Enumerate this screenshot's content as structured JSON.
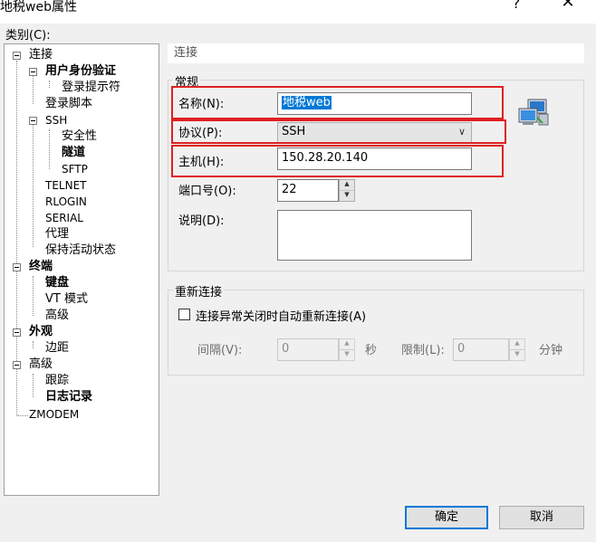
{
  "window": {
    "title": "地税web属性",
    "help_glyph": "?",
    "close_glyph": "✕"
  },
  "category_label": "类别(C):",
  "tree": [
    {
      "label": "连接",
      "bold": true
    },
    {
      "label": "用户身份验证",
      "bold": true
    },
    {
      "label": "登录提示符",
      "bold": false
    },
    {
      "label": "登录脚本",
      "bold": false
    },
    {
      "label": "SSH",
      "bold": false
    },
    {
      "label": "安全性",
      "bold": false
    },
    {
      "label": "隧道",
      "bold": true
    },
    {
      "label": "SFTP",
      "bold": false
    },
    {
      "label": "TELNET",
      "bold": false
    },
    {
      "label": "RLOGIN",
      "bold": false
    },
    {
      "label": "SERIAL",
      "bold": false
    },
    {
      "label": "代理",
      "bold": false
    },
    {
      "label": "保持活动状态",
      "bold": false
    },
    {
      "label": "终端",
      "bold": true
    },
    {
      "label": "键盘",
      "bold": true
    },
    {
      "label": "VT 模式",
      "bold": false
    },
    {
      "label": "高级",
      "bold": false
    },
    {
      "label": "外观",
      "bold": true
    },
    {
      "label": "边距",
      "bold": false
    },
    {
      "label": "高级",
      "bold": false
    },
    {
      "label": "跟踪",
      "bold": false
    },
    {
      "label": "日志记录",
      "bold": true
    },
    {
      "label": "ZMODEM",
      "bold": false
    }
  ],
  "panel": {
    "header": "连接",
    "general_group": "常规",
    "name_label": "名称(N):",
    "name_value": "地税web",
    "protocol_label": "协议(P):",
    "protocol_value": "SSH",
    "host_label": "主机(H):",
    "host_value": "150.28.20.140",
    "port_label": "端口号(O):",
    "port_value": "22",
    "desc_label": "说明(D):",
    "desc_value": ""
  },
  "reconnect": {
    "group": "重新连接",
    "auto_label": "连接异常关闭时自动重新连接(A)",
    "auto_checked": false,
    "interval_label": "间隔(V):",
    "interval_value": "0",
    "interval_unit": "秒",
    "limit_label": "限制(L):",
    "limit_value": "0",
    "limit_unit": "分钟"
  },
  "buttons": {
    "ok": "确定",
    "cancel": "取消"
  },
  "colors": {
    "highlight_border": "#e02020",
    "selection": "#0078d7"
  }
}
